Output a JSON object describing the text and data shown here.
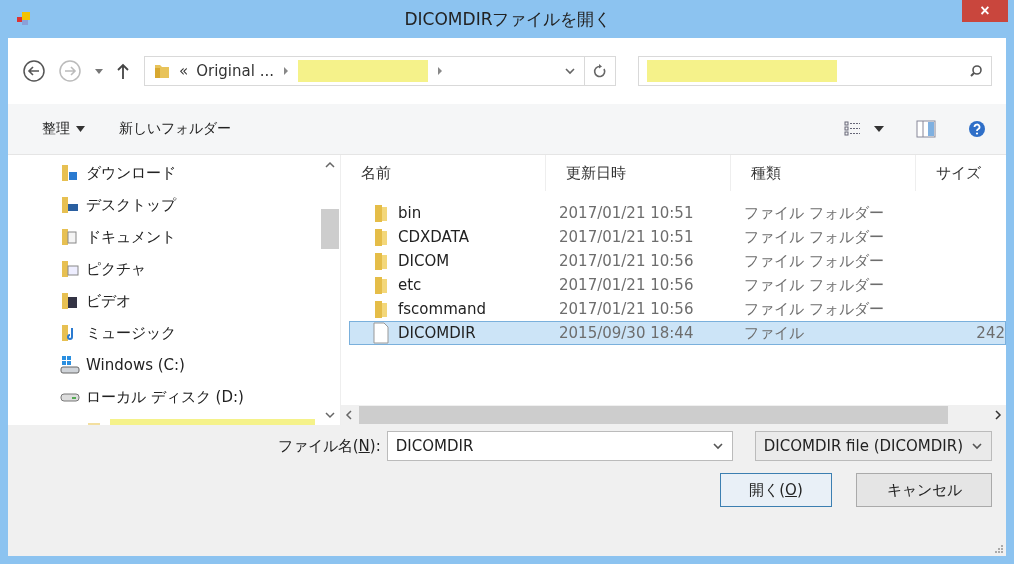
{
  "window": {
    "title": "DICOMDIRファイルを開く",
    "close": "×"
  },
  "address": {
    "crumbs": [
      "«",
      "Original ..."
    ]
  },
  "toolbar": {
    "organize": "整理",
    "new_folder": "新しいフォルダー"
  },
  "sidebar": {
    "items": [
      {
        "label": "ダウンロード",
        "kind": "folder"
      },
      {
        "label": "デスクトップ",
        "kind": "folder"
      },
      {
        "label": "ドキュメント",
        "kind": "folder"
      },
      {
        "label": "ピクチャ",
        "kind": "folder"
      },
      {
        "label": "ビデオ",
        "kind": "folder"
      },
      {
        "label": "ミュージック",
        "kind": "folder"
      },
      {
        "label": "Windows (C:)",
        "kind": "system-drive"
      },
      {
        "label": "ローカル ディスク (D:)",
        "kind": "drive"
      }
    ]
  },
  "table": {
    "columns": [
      "名前",
      "更新日時",
      "種類",
      "サイズ"
    ],
    "rows": [
      {
        "name": "bin",
        "date": "2017/01/21 10:51",
        "type": "ファイル フォルダー",
        "kind": "folder",
        "selected": false
      },
      {
        "name": "CDXDATA",
        "date": "2017/01/21 10:51",
        "type": "ファイル フォルダー",
        "kind": "folder",
        "selected": false
      },
      {
        "name": "DICOM",
        "date": "2017/01/21 10:56",
        "type": "ファイル フォルダー",
        "kind": "folder",
        "selected": false
      },
      {
        "name": "etc",
        "date": "2017/01/21 10:56",
        "type": "ファイル フォルダー",
        "kind": "folder",
        "selected": false
      },
      {
        "name": "fscommand",
        "date": "2017/01/21 10:56",
        "type": "ファイル フォルダー",
        "kind": "folder",
        "selected": false
      },
      {
        "name": "DICOMDIR",
        "date": "2015/09/30 18:44",
        "type": "ファイル",
        "size": "242",
        "kind": "file",
        "selected": true
      }
    ]
  },
  "filename": {
    "label_before": "ファイル名(",
    "access_key": "N",
    "label_after": "):",
    "value": "DICOMDIR"
  },
  "filter": {
    "value": "DICOMDIR file (DICOMDIR)"
  },
  "buttons": [
    {
      "before": "開く(",
      "access_key": "O",
      "after": ")",
      "kind": "primary"
    },
    {
      "label": "キャンセル",
      "kind": "normal"
    }
  ]
}
